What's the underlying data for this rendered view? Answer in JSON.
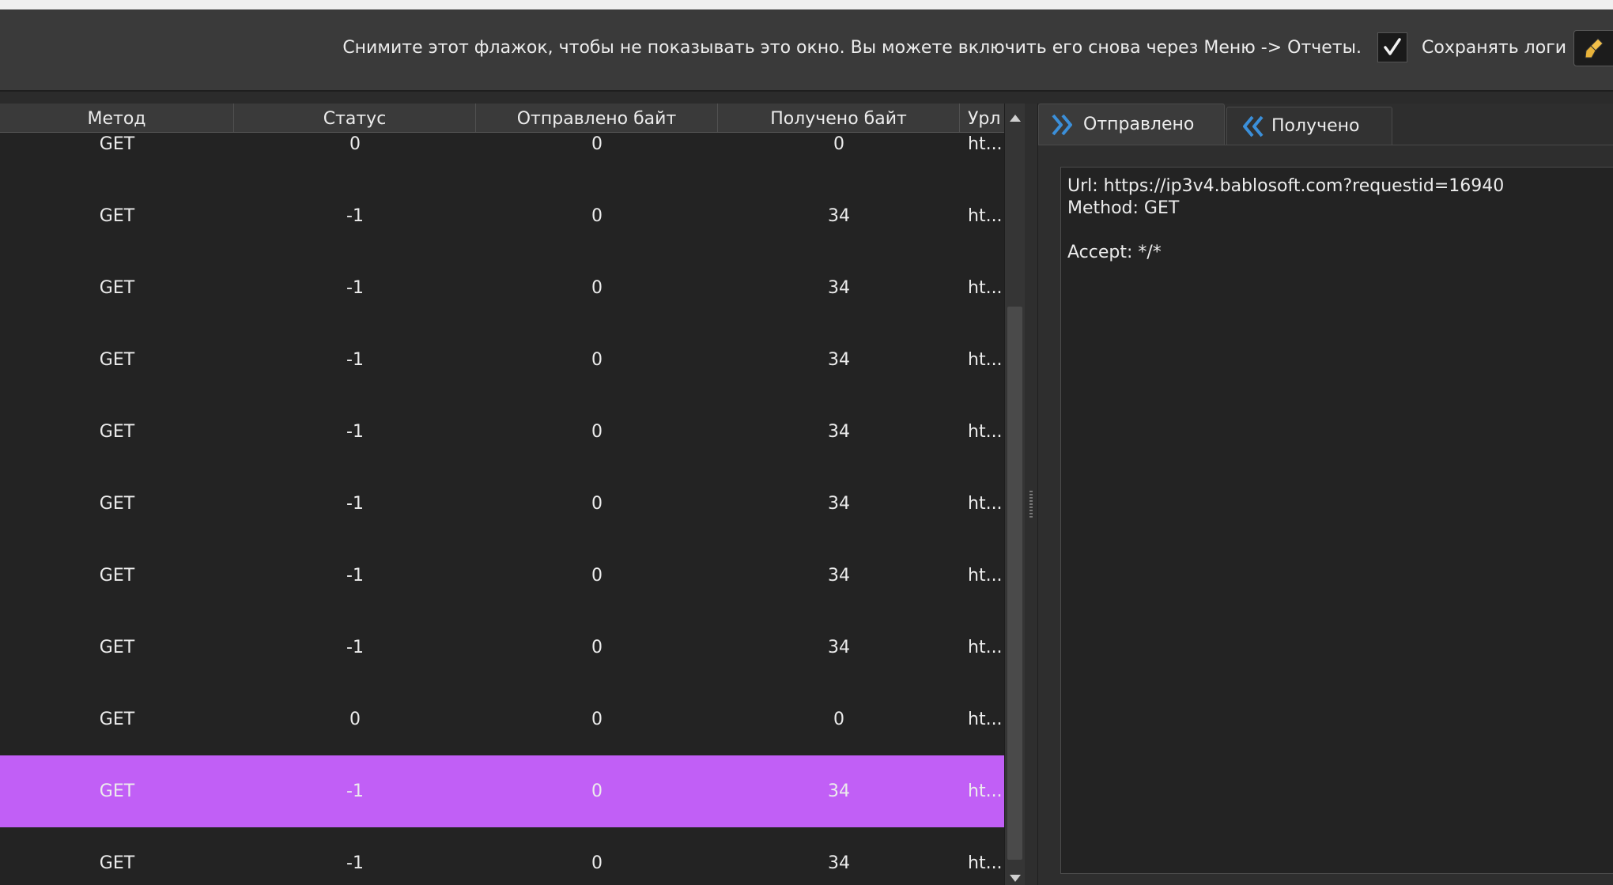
{
  "top_bar": {
    "hint": "Снимите этот флажок, чтобы не показывать это окно. Вы можете включить его снова через Меню -> Отчеты.",
    "save_logs_label": "Сохранять логи",
    "save_logs_checked": true
  },
  "table": {
    "columns": [
      "Метод",
      "Статус",
      "Отправлено байт",
      "Получено байт",
      "Урл"
    ],
    "rows": [
      {
        "method": "GET",
        "status": "0",
        "sent": "0",
        "received": "0",
        "url": "ht..."
      },
      {
        "method": "GET",
        "status": "-1",
        "sent": "0",
        "received": "34",
        "url": "ht..."
      },
      {
        "method": "GET",
        "status": "-1",
        "sent": "0",
        "received": "34",
        "url": "ht..."
      },
      {
        "method": "GET",
        "status": "-1",
        "sent": "0",
        "received": "34",
        "url": "ht..."
      },
      {
        "method": "GET",
        "status": "-1",
        "sent": "0",
        "received": "34",
        "url": "ht..."
      },
      {
        "method": "GET",
        "status": "-1",
        "sent": "0",
        "received": "34",
        "url": "ht..."
      },
      {
        "method": "GET",
        "status": "-1",
        "sent": "0",
        "received": "34",
        "url": "ht..."
      },
      {
        "method": "GET",
        "status": "-1",
        "sent": "0",
        "received": "34",
        "url": "ht..."
      },
      {
        "method": "GET",
        "status": "0",
        "sent": "0",
        "received": "0",
        "url": "ht..."
      },
      {
        "method": "GET",
        "status": "-1",
        "sent": "0",
        "received": "34",
        "url": "ht..."
      },
      {
        "method": "GET",
        "status": "-1",
        "sent": "0",
        "received": "34",
        "url": "ht..."
      }
    ],
    "selected_row": 9,
    "selected_color": "#c15ff6"
  },
  "tabs": {
    "sent_label": "Отправлено",
    "received_label": "Получено",
    "active": "sent",
    "icon_color": "#3b8fd9"
  },
  "request": {
    "text": "Url: https://ip3v4.bablosoft.com?requestid=16940\nMethod: GET\n\nAccept: */*"
  }
}
